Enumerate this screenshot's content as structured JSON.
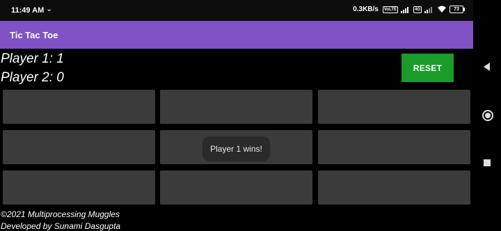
{
  "status_bar": {
    "time": "11:49 AM",
    "chevron": "⌄",
    "network_speed": "0.3KB/s",
    "sim_badge_1": "VoLTE",
    "sim_badge_2": "4G",
    "battery": "73"
  },
  "app_bar": {
    "title": "Tic Tac Toe"
  },
  "scores": {
    "player1": "Player 1: 1",
    "player2": "Player 2: 0"
  },
  "reset_label": "RESET",
  "board": {
    "cells": [
      "",
      "",
      "",
      "",
      "",
      "",
      "",
      "",
      ""
    ]
  },
  "toast": {
    "message": "Player 1 wins!"
  },
  "footer": {
    "copyright": "©2021 Multiprocessing Muggles",
    "developer": "Developed by Sunami Dasgupta"
  },
  "colors": {
    "app_bar": "#8052c4",
    "reset_button": "#1b9b2a",
    "cell": "#3b3b3b",
    "background": "#000000"
  },
  "nav_bar": {
    "back_icon": "triangle-back-icon",
    "home_icon": "circle-home-icon",
    "recents_icon": "square-recents-icon"
  }
}
